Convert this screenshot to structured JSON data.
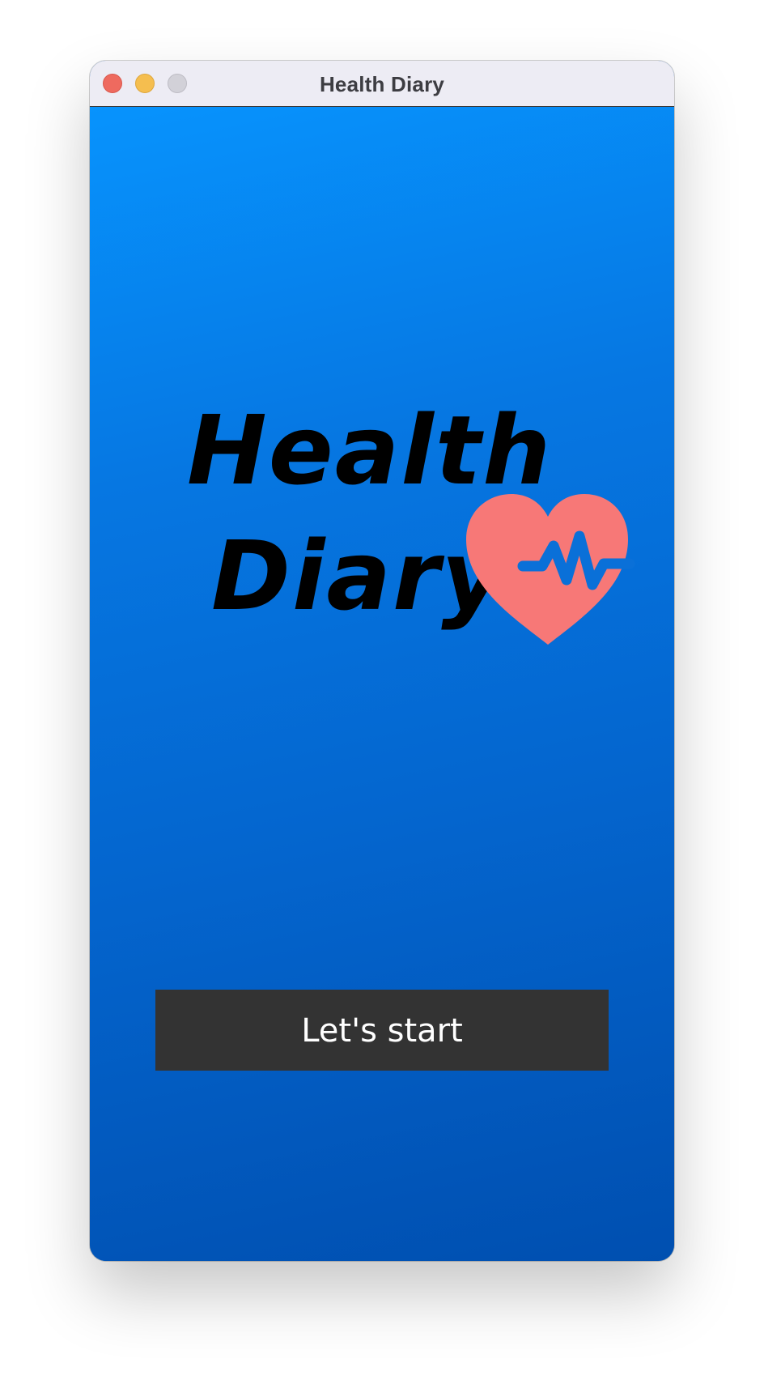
{
  "window": {
    "title": "Health Diary"
  },
  "logo": {
    "line1": "Health",
    "line2": "Diary",
    "icon": "heart-pulse-icon",
    "heart_color": "#f77877",
    "pulse_color": "#0a70d8"
  },
  "actions": {
    "start_label": "Let's start"
  },
  "colors": {
    "background_top": "#0793fd",
    "background_bottom": "#004fb0",
    "button_background": "#333333",
    "button_text": "#ffffff"
  }
}
